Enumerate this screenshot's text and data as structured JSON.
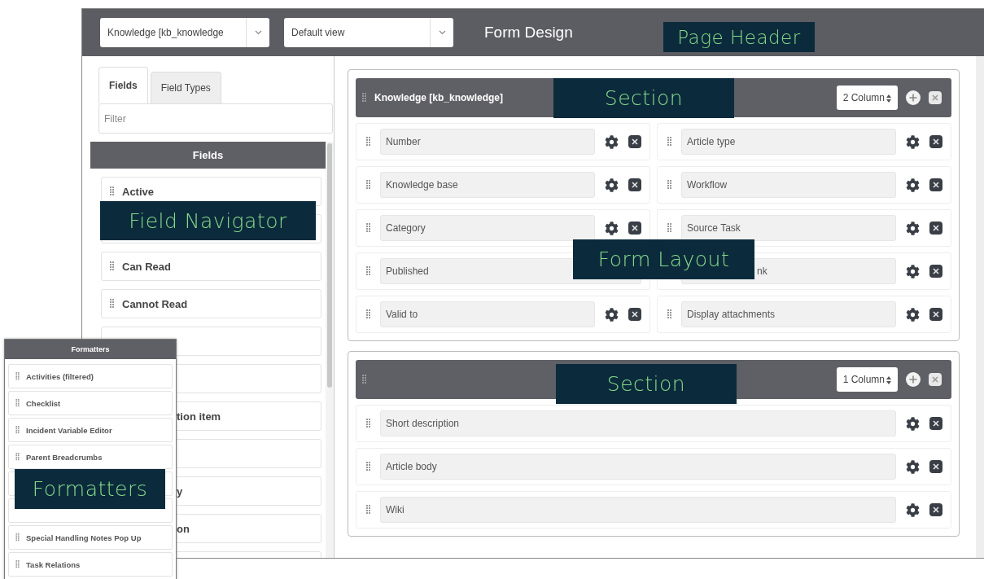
{
  "header": {
    "table_select": "Knowledge [kb_knowledge",
    "view_select": "Default view",
    "title": "Form Design"
  },
  "left_panel": {
    "tabs": [
      {
        "label": "Fields",
        "selected": true
      },
      {
        "label": "Field Types",
        "selected": false
      }
    ],
    "filter": {
      "placeholder": "Filter"
    },
    "list_title": "Fields",
    "items": [
      {
        "kind": "full",
        "label": "Active"
      },
      {
        "kind": "blank"
      },
      {
        "kind": "full",
        "label": "Can Read"
      },
      {
        "kind": "full",
        "label": "Cannot Read"
      },
      {
        "kind": "blank"
      },
      {
        "kind": "blank"
      },
      {
        "kind": "partial",
        "label": "tion item"
      },
      {
        "kind": "blank"
      },
      {
        "kind": "partial",
        "label": "y"
      },
      {
        "kind": "partial",
        "label": "on"
      },
      {
        "kind": "blank"
      }
    ]
  },
  "sections": [
    {
      "kind": "two_column",
      "title": "Knowledge [kb_knowledge]",
      "columns": "2 Column",
      "fields": [
        {
          "kind": "full",
          "label": "Number"
        },
        {
          "kind": "full",
          "label": "Article type"
        },
        {
          "kind": "full",
          "label": "Knowledge base"
        },
        {
          "kind": "full",
          "label": "Workflow"
        },
        {
          "kind": "full",
          "label": "Category"
        },
        {
          "kind": "full",
          "label": "Source Task"
        },
        {
          "kind": "no_actions",
          "label": "Published"
        },
        {
          "kind": "partial",
          "label": "nk"
        },
        {
          "kind": "full",
          "label": "Valid to"
        },
        {
          "kind": "full",
          "label": "Display attachments"
        }
      ]
    },
    {
      "kind": "one_column",
      "columns": "1 Column",
      "fields": [
        {
          "kind": "full",
          "label": "Short description"
        },
        {
          "kind": "full",
          "label": "Article body"
        },
        {
          "kind": "full",
          "label": "Wiki"
        }
      ]
    }
  ],
  "formatters": {
    "title": "Formatters",
    "items": [
      {
        "kind": "full",
        "label": "Activities (filtered)"
      },
      {
        "kind": "full",
        "label": "Checklist"
      },
      {
        "kind": "full",
        "label": "Incident Variable Editor"
      },
      {
        "kind": "full",
        "label": "Parent Breadcrumbs"
      },
      {
        "kind": "blank"
      },
      {
        "kind": "blank"
      },
      {
        "kind": "full",
        "label": "Special Handling Notes Pop Up"
      },
      {
        "kind": "full",
        "label": "Task Relations"
      }
    ]
  },
  "callouts": [
    {
      "label": "Page Header"
    },
    {
      "label": "Field Navigator"
    },
    {
      "label": "Section"
    },
    {
      "label": "Form Layout"
    },
    {
      "label": "Section"
    },
    {
      "label": "Formatters"
    }
  ]
}
